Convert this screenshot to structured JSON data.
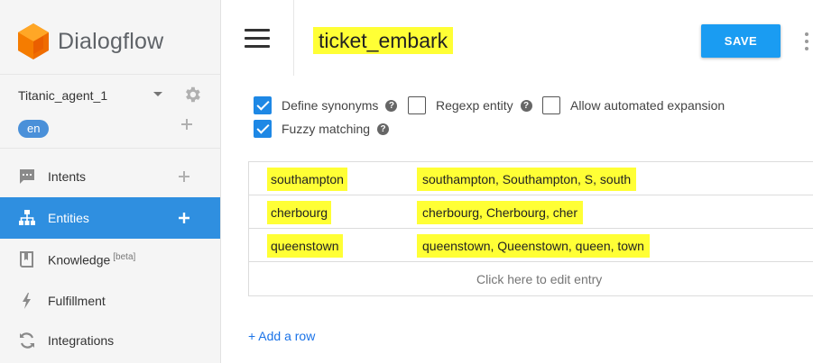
{
  "sidebar": {
    "brand": "Dialogflow",
    "agent": "Titanic_agent_1",
    "language": "en",
    "nav": [
      {
        "label": "Intents",
        "icon": "chat-bubble-icon"
      },
      {
        "label": "Entities",
        "icon": "sitemap-icon",
        "active": true
      },
      {
        "label": "Knowledge",
        "badge": "[beta]",
        "icon": "book-icon"
      },
      {
        "label": "Fulfillment",
        "icon": "lightning-icon"
      },
      {
        "label": "Integrations",
        "icon": "refresh-icon"
      }
    ]
  },
  "header": {
    "title": "ticket_embark",
    "save_label": "SAVE"
  },
  "options": {
    "define_synonyms": {
      "label": "Define synonyms",
      "checked": true
    },
    "regexp_entity": {
      "label": "Regexp entity",
      "checked": false
    },
    "allow_expansion": {
      "label": "Allow automated expansion",
      "checked": false
    },
    "fuzzy_matching": {
      "label": "Fuzzy matching",
      "checked": true
    }
  },
  "entries": [
    {
      "value": "southampton",
      "synonyms": "southampton, Southampton, S, south"
    },
    {
      "value": "cherbourg",
      "synonyms": "cherbourg, Cherbourg, cher"
    },
    {
      "value": "queenstown",
      "synonyms": "queenstown, Queenstown, queen, town"
    }
  ],
  "edit_hint": "Click here to edit entry",
  "add_row": "+ Add a row",
  "colors": {
    "accent": "#2f8fe0",
    "save": "#1a9cf2",
    "highlight": "#ffff35",
    "checkbox": "#1e88e5"
  }
}
